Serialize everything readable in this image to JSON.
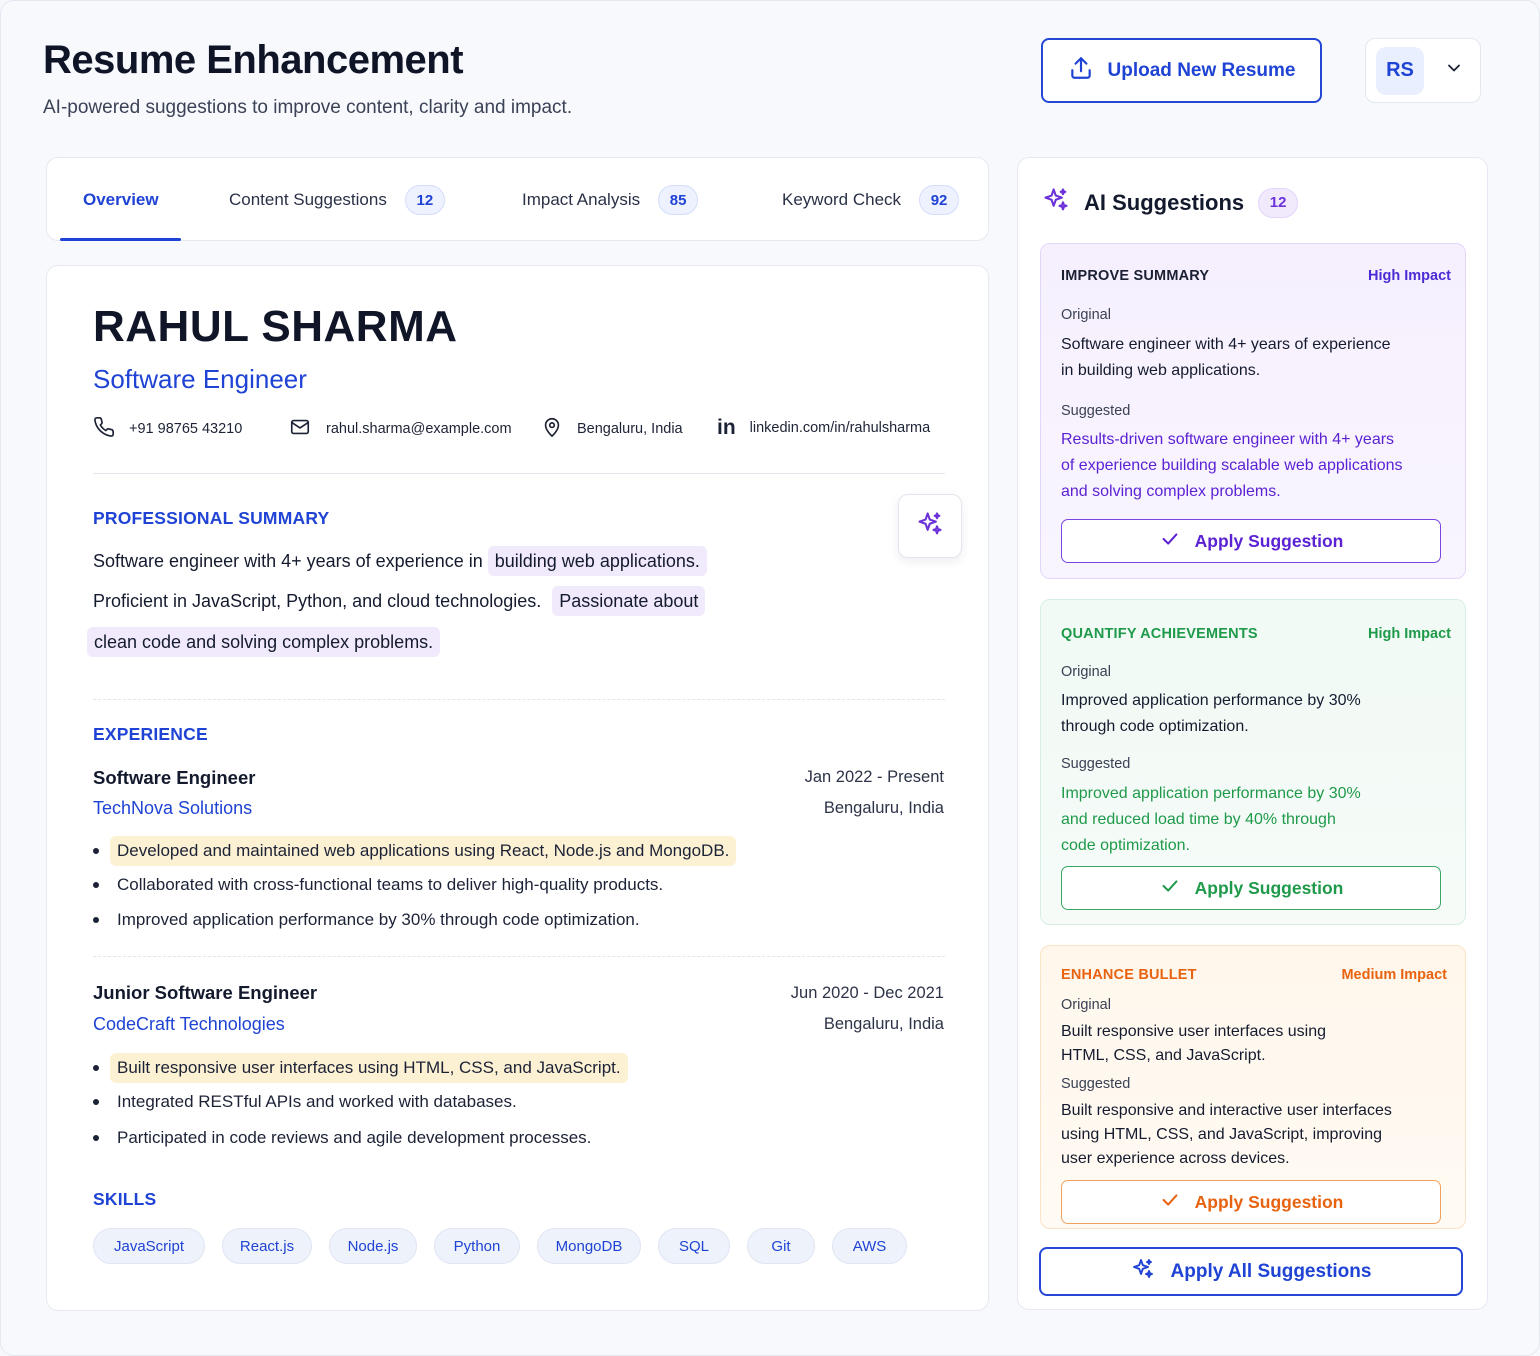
{
  "header": {
    "title": "Resume Enhancement",
    "subtitle": "AI-powered suggestions to improve content, clarity and impact.",
    "upload_label": "Upload New Resume",
    "avatar_initials": "RS"
  },
  "tabs": [
    {
      "label": "Overview",
      "active": true
    },
    {
      "label": "Content Suggestions",
      "count": "12"
    },
    {
      "label": "Impact Analysis",
      "count": "85"
    },
    {
      "label": "Keyword Check",
      "count": "92"
    }
  ],
  "resume": {
    "name": "RAHUL SHARMA",
    "role": "Software Engineer",
    "contact": {
      "phone": "+91 98765 43210",
      "email": "rahul.sharma@example.com",
      "location": "Bengaluru, India",
      "linkedin": "linkedin.com/in/rahulsharma"
    },
    "summary": {
      "heading": "PROFESSIONAL SUMMARY",
      "line1_plain": "Software engineer with 4+ years of experience in",
      "line1_highlight": "building web applications.",
      "line2_plain": "Proficient in JavaScript, Python, and cloud technologies.",
      "line2_highlight": "Passionate about",
      "line3_highlight": "clean code and solving complex problems."
    },
    "experience": {
      "heading": "EXPERIENCE",
      "jobs": [
        {
          "title": "Software Engineer",
          "company": "TechNova Solutions",
          "dates": "Jan 2022 - Present",
          "location": "Bengaluru, India",
          "bullets": [
            "Developed and maintained web applications using React, Node.js and MongoDB.",
            "Collaborated with cross-functional teams to deliver high-quality products.",
            "Improved application performance by 30% through code optimization."
          ]
        },
        {
          "title": "Junior Software Engineer",
          "company": "CodeCraft Technologies",
          "dates": "Jun 2020 - Dec 2021",
          "location": "Bengaluru, India",
          "bullets": [
            "Built responsive user interfaces using HTML, CSS, and JavaScript.",
            "Integrated RESTful APIs and worked with databases.",
            "Participated in code reviews and agile development processes."
          ]
        }
      ]
    },
    "skills": {
      "heading": "SKILLS",
      "items": [
        "JavaScript",
        "React.js",
        "Node.js",
        "Python",
        "MongoDB",
        "SQL",
        "Git",
        "AWS"
      ]
    }
  },
  "ai_panel": {
    "title": "AI Suggestions",
    "count": "12",
    "original_label": "Original",
    "suggested_label": "Suggested",
    "apply_label": "Apply Suggestion",
    "apply_all_label": "Apply All Suggestions",
    "cards": [
      {
        "heading": "IMPROVE SUMMARY",
        "impact": "High Impact",
        "original": [
          "Software engineer with 4+ years of experience",
          "in building web applications."
        ],
        "suggested": [
          "Results-driven software engineer with 4+ years",
          "of experience building scalable web applications",
          "and solving complex problems."
        ]
      },
      {
        "heading": "QUANTIFY ACHIEVEMENTS",
        "impact": "High Impact",
        "original": [
          "Improved application performance by 30%",
          "through code optimization."
        ],
        "suggested": [
          "Improved application performance by 30%",
          "and reduced load time by 40% through",
          "code optimization."
        ]
      },
      {
        "heading": "ENHANCE BULLET",
        "impact": "Medium Impact",
        "original": [
          "Built responsive user interfaces using",
          "HTML, CSS, and JavaScript."
        ],
        "suggested": [
          "Built responsive and interactive user interfaces",
          "using HTML, CSS, and JavaScript, improving",
          "user experience across devices."
        ]
      }
    ]
  },
  "colors": {
    "primary": "#1f43d4",
    "purple": "#6b32d9",
    "green": "#1f9a4a",
    "orange": "#e8630f"
  }
}
